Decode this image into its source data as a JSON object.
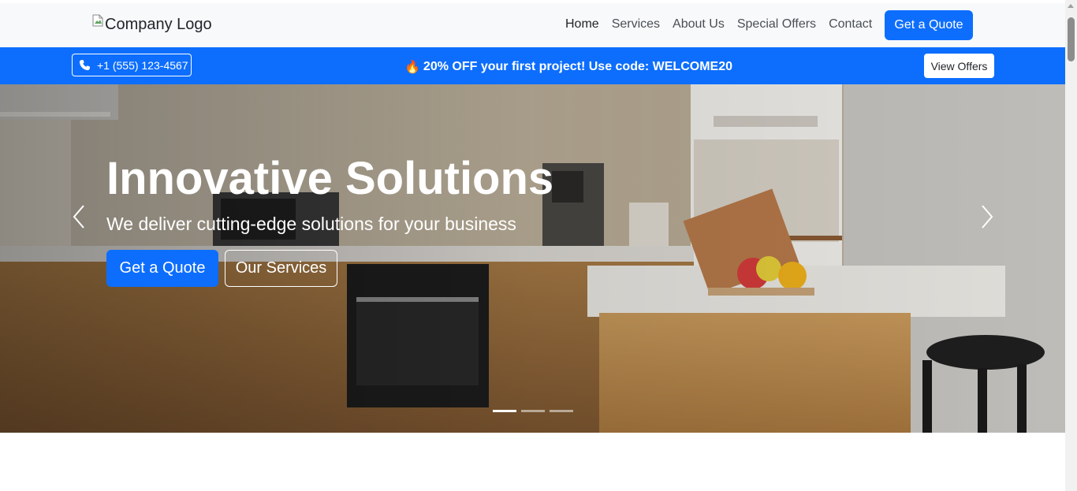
{
  "navbar": {
    "logo_alt": "Company Logo",
    "links": [
      {
        "label": "Home"
      },
      {
        "label": "Services"
      },
      {
        "label": "About Us"
      },
      {
        "label": "Special Offers"
      },
      {
        "label": "Contact"
      }
    ],
    "cta_label": "Get a Quote"
  },
  "promo_bar": {
    "phone": "+1 (555) 123-4567",
    "offer_text": "20% OFF your first project! Use code: WELCOME20",
    "offer_icon": "🔥",
    "view_offers_label": "View Offers"
  },
  "hero": {
    "title": "Innovative Solutions",
    "subtitle": "We deliver cutting-edge solutions for your business",
    "primary_button": "Get a Quote",
    "secondary_button": "Our Services",
    "slide_count": 3,
    "active_slide": 1
  },
  "colors": {
    "brand_primary": "#0d6efd",
    "navbar_bg": "#f8f9fa",
    "text_dark": "#212529"
  },
  "icons": {
    "phone": "phone-icon",
    "prev": "chevron-left-icon",
    "next": "chevron-right-icon",
    "broken_image": "broken-image-icon"
  }
}
